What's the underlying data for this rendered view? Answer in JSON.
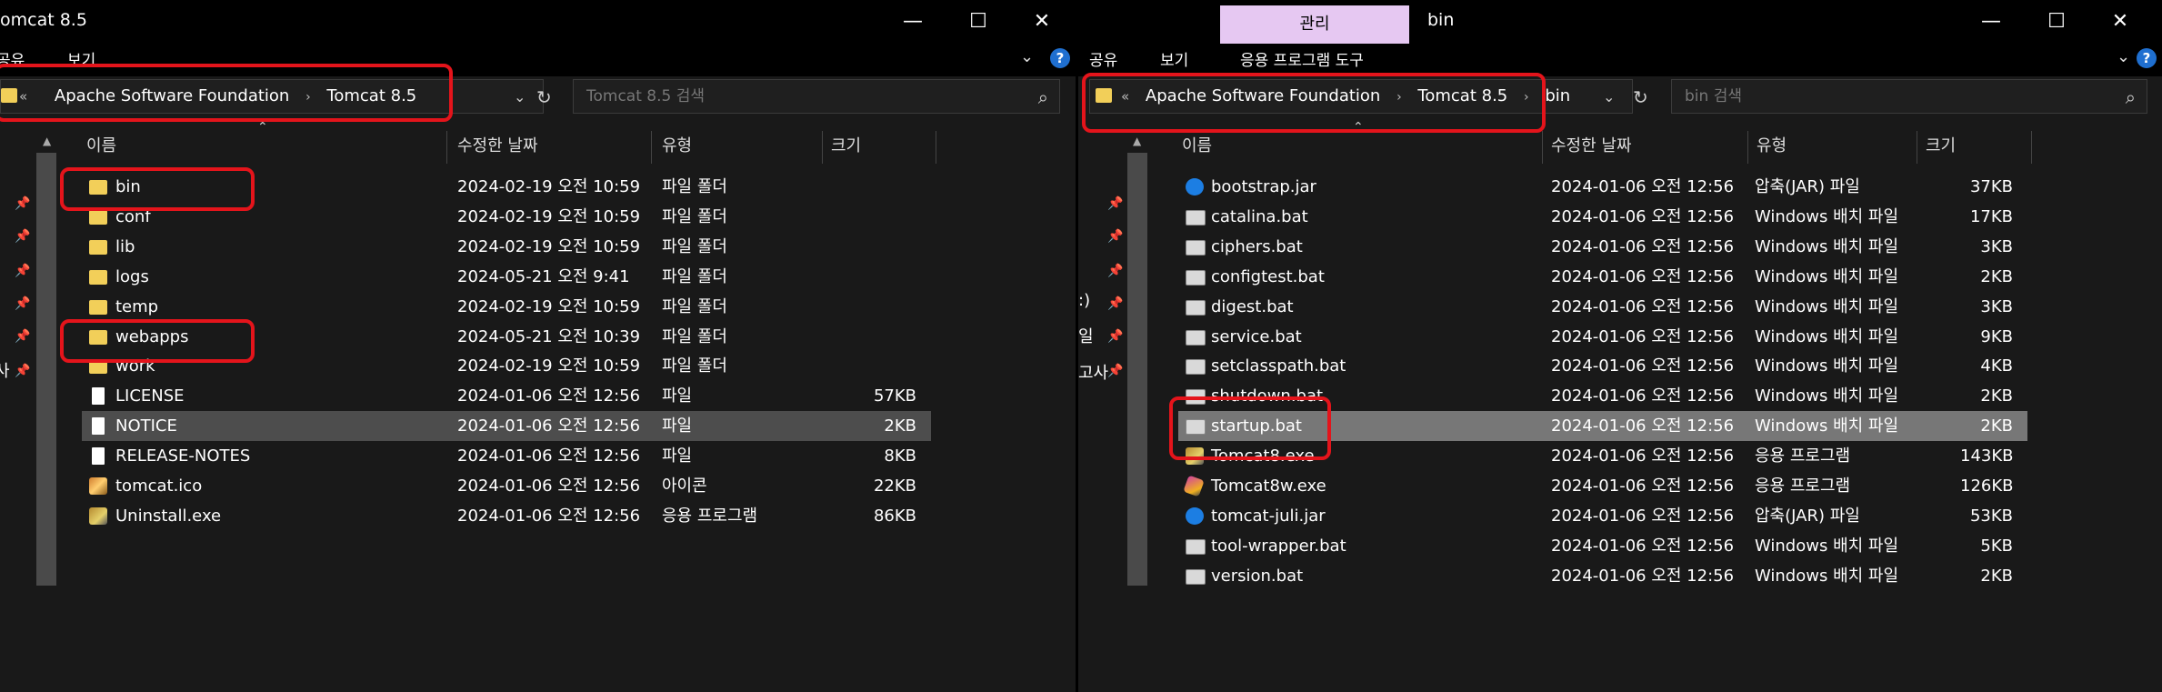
{
  "left": {
    "title": "omcat 8.5",
    "ribbon": {
      "tabs": [
        "공유",
        "보기"
      ]
    },
    "address": {
      "back": "«",
      "crumbs": [
        "Apache Software Foundation",
        "Tomcat 8.5"
      ]
    },
    "search": {
      "placeholder": "Tomcat 8.5 검색"
    },
    "columns": {
      "name": "이름",
      "date": "수정한 날짜",
      "type": "유형",
      "size": "크기"
    },
    "files": [
      {
        "name": "bin",
        "date": "2024-02-19 오전 10:59",
        "type": "파일 폴더",
        "size": "",
        "icon": "folder-icon"
      },
      {
        "name": "conf",
        "date": "2024-02-19 오전 10:59",
        "type": "파일 폴더",
        "size": "",
        "icon": "folder-icon"
      },
      {
        "name": "lib",
        "date": "2024-02-19 오전 10:59",
        "type": "파일 폴더",
        "size": "",
        "icon": "folder-icon"
      },
      {
        "name": "logs",
        "date": "2024-05-21 오전 9:41",
        "type": "파일 폴더",
        "size": "",
        "icon": "folder-icon"
      },
      {
        "name": "temp",
        "date": "2024-02-19 오전 10:59",
        "type": "파일 폴더",
        "size": "",
        "icon": "folder-icon"
      },
      {
        "name": "webapps",
        "date": "2024-05-21 오전 10:39",
        "type": "파일 폴더",
        "size": "",
        "icon": "folder-icon"
      },
      {
        "name": "work",
        "date": "2024-02-19 오전 10:59",
        "type": "파일 폴더",
        "size": "",
        "icon": "folder-icon"
      },
      {
        "name": "LICENSE",
        "date": "2024-01-06 오전 12:56",
        "type": "파일",
        "size": "57KB",
        "icon": "file-icon"
      },
      {
        "name": "NOTICE",
        "date": "2024-01-06 오전 12:56",
        "type": "파일",
        "size": "2KB",
        "icon": "file-icon",
        "selected": true
      },
      {
        "name": "RELEASE-NOTES",
        "date": "2024-01-06 오전 12:56",
        "type": "파일",
        "size": "8KB",
        "icon": "file-icon"
      },
      {
        "name": "tomcat.ico",
        "date": "2024-01-06 오전 12:56",
        "type": "아이콘",
        "size": "22KB",
        "icon": "tomcat-icon"
      },
      {
        "name": "Uninstall.exe",
        "date": "2024-01-06 오전 12:56",
        "type": "응용 프로그램",
        "size": "86KB",
        "icon": "exe-icon"
      }
    ],
    "nav_fragments": [
      "사"
    ]
  },
  "right": {
    "title": "bin",
    "manage_tab": "관리",
    "ribbon": {
      "tabs": [
        "공유",
        "보기"
      ],
      "context_tab": "응용 프로그램 도구"
    },
    "address": {
      "back": "«",
      "crumbs": [
        "Apache Software Foundation",
        "Tomcat 8.5",
        "bin"
      ]
    },
    "search": {
      "placeholder": "bin 검색"
    },
    "columns": {
      "name": "이름",
      "date": "수정한 날짜",
      "type": "유형",
      "size": "크기"
    },
    "files": [
      {
        "name": "bootstrap.jar",
        "date": "2024-01-06 오전 12:56",
        "type": "압축(JAR) 파일",
        "size": "37KB",
        "icon": "jar-icon"
      },
      {
        "name": "catalina.bat",
        "date": "2024-01-06 오전 12:56",
        "type": "Windows 배치 파일",
        "size": "17KB",
        "icon": "batch-file-icon"
      },
      {
        "name": "ciphers.bat",
        "date": "2024-01-06 오전 12:56",
        "type": "Windows 배치 파일",
        "size": "3KB",
        "icon": "batch-file-icon"
      },
      {
        "name": "configtest.bat",
        "date": "2024-01-06 오전 12:56",
        "type": "Windows 배치 파일",
        "size": "2KB",
        "icon": "batch-file-icon"
      },
      {
        "name": "digest.bat",
        "date": "2024-01-06 오전 12:56",
        "type": "Windows 배치 파일",
        "size": "3KB",
        "icon": "batch-file-icon"
      },
      {
        "name": "service.bat",
        "date": "2024-01-06 오전 12:56",
        "type": "Windows 배치 파일",
        "size": "9KB",
        "icon": "batch-file-icon"
      },
      {
        "name": "setclasspath.bat",
        "date": "2024-01-06 오전 12:56",
        "type": "Windows 배치 파일",
        "size": "4KB",
        "icon": "batch-file-icon"
      },
      {
        "name": "shutdown.bat",
        "date": "2024-01-06 오전 12:56",
        "type": "Windows 배치 파일",
        "size": "2KB",
        "icon": "batch-file-icon"
      },
      {
        "name": "startup.bat",
        "date": "2024-01-06 오전 12:56",
        "type": "Windows 배치 파일",
        "size": "2KB",
        "icon": "batch-file-icon",
        "selected": true
      },
      {
        "name": "Tomcat8.exe",
        "date": "2024-01-06 오전 12:56",
        "type": "응용 프로그램",
        "size": "143KB",
        "icon": "exe-icon"
      },
      {
        "name": "Tomcat8w.exe",
        "date": "2024-01-06 오전 12:56",
        "type": "응용 프로그램",
        "size": "126KB",
        "icon": "wand-exe-icon"
      },
      {
        "name": "tomcat-juli.jar",
        "date": "2024-01-06 오전 12:56",
        "type": "압축(JAR) 파일",
        "size": "53KB",
        "icon": "jar-icon"
      },
      {
        "name": "tool-wrapper.bat",
        "date": "2024-01-06 오전 12:56",
        "type": "Windows 배치 파일",
        "size": "5KB",
        "icon": "batch-file-icon"
      },
      {
        "name": "version.bat",
        "date": "2024-01-06 오전 12:56",
        "type": "Windows 배치 파일",
        "size": "2KB",
        "icon": "batch-file-icon"
      }
    ],
    "nav_fragments": [
      ":)",
      "일",
      "고사"
    ]
  },
  "window_controls": {
    "minimize": "—",
    "maximize": "☐",
    "close": "✕"
  },
  "colors": {
    "highlight": "#e4141b",
    "manage_tab": "#e6c8f2",
    "folder": "#f2cf59",
    "selection": "#4d4d4d"
  }
}
